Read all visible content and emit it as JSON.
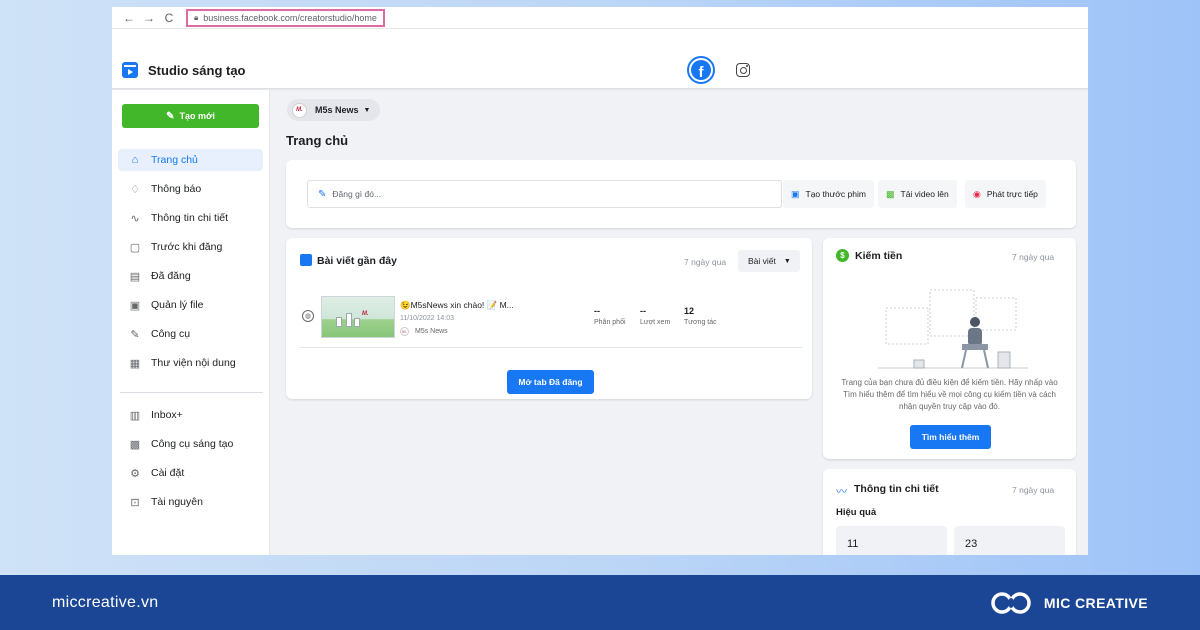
{
  "browser": {
    "back": "←",
    "forward": "→",
    "reload": "C",
    "url": "business.facebook.com/creatorstudio/home"
  },
  "header": {
    "app_title": "Studio sáng tạo",
    "facebook_letter": "f"
  },
  "sidebar": {
    "create_label": "Tạo mới",
    "items": [
      {
        "label": "Trang chủ",
        "icon": "home-icon",
        "glyph": "⌂"
      },
      {
        "label": "Thông báo",
        "icon": "bell-icon",
        "glyph": "♫"
      },
      {
        "label": "Thông tin chi tiết",
        "icon": "insights-icon",
        "glyph": "∿"
      },
      {
        "label": "Trước khi đăng",
        "icon": "draft-icon",
        "glyph": "▢"
      },
      {
        "label": "Đã đăng",
        "icon": "published-icon",
        "glyph": "▤"
      },
      {
        "label": "Quản lý file",
        "icon": "file-icon",
        "glyph": "▣"
      },
      {
        "label": "Công cụ",
        "icon": "tools-icon",
        "glyph": "✎"
      },
      {
        "label": "Thư viện nội dung",
        "icon": "library-icon",
        "glyph": "▦"
      }
    ],
    "items2": [
      {
        "label": "Inbox+",
        "icon": "inbox-icon",
        "glyph": "▥"
      },
      {
        "label": "Công cụ sáng tạo",
        "icon": "creator-tools-icon",
        "glyph": "▩"
      },
      {
        "label": "Cài đặt",
        "icon": "gear-icon",
        "glyph": "⚙"
      },
      {
        "label": "Tài nguyên",
        "icon": "resources-icon",
        "glyph": "⊡"
      }
    ]
  },
  "main": {
    "page_name": "M5s News",
    "page_logo_text": "M.",
    "title": "Trang chủ",
    "composer": {
      "placeholder": "Đăng gì đó...",
      "actions": [
        "Tạo thước phim",
        "Tải video lên",
        "Phát trực tiếp"
      ]
    },
    "recent": {
      "title": "Bài viết gần đây",
      "period": "7 ngày qua",
      "filter": "Bài viết",
      "post": {
        "title": "😉M5sNews xin chào! 📝 M...",
        "date": "11/10/2022 14:03",
        "page": "M5s News",
        "thumb_brand": "M."
      },
      "stats": [
        {
          "value": "--",
          "label": "Phân phối"
        },
        {
          "value": "--",
          "label": "Lượt xem"
        },
        {
          "value": "12",
          "label": "Tương tác"
        }
      ],
      "open_tab_label": "Mở tab Đã đăng"
    },
    "monetize": {
      "title": "Kiếm tiền",
      "period": "7 ngày qua",
      "description": "Trang của bạn chưa đủ điều kiện để kiếm tiền. Hãy nhấp vào Tìm hiểu thêm để tìm hiểu về mọi công cụ kiếm tiền và cách nhận quyền truy cập vào đó.",
      "button": "Tìm hiểu thêm"
    },
    "insights": {
      "title": "Thông tin chi tiết",
      "period": "7 ngày qua",
      "subhead": "Hiệu quả",
      "metrics": [
        "11",
        "23"
      ]
    }
  },
  "footer": {
    "site": "miccreative.vn",
    "brand": "MIC CREATIVE"
  },
  "colors": {
    "accent": "#1877f2",
    "create_green": "#42b72a",
    "footer_bg": "#1a4695",
    "url_highlight": "#e06aa5"
  }
}
